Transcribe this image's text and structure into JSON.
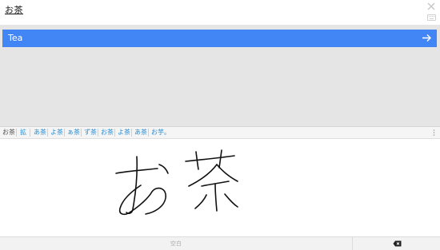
{
  "query": {
    "text": "お茶"
  },
  "suggestions": [
    {
      "label": "Tea"
    }
  ],
  "candidates": [
    {
      "label": "お茶"
    },
    {
      "label": "拡"
    },
    {
      "label": "あ茶"
    },
    {
      "label": "よ茶"
    },
    {
      "label": "ぁ茶"
    },
    {
      "label": "ず茶"
    },
    {
      "label": "お茶"
    },
    {
      "label": "よ茶"
    },
    {
      "label": "あ茶"
    },
    {
      "label": "お芋。"
    }
  ],
  "bottom": {
    "space_label": "空白"
  },
  "colors": {
    "accent": "#4285f4",
    "candidate": "#2a8fd4",
    "panel": "#e5e5e5"
  },
  "icons": [
    "close-icon",
    "keyboard-icon",
    "arrow-right-icon",
    "more-vertical-icon",
    "backspace-icon"
  ]
}
